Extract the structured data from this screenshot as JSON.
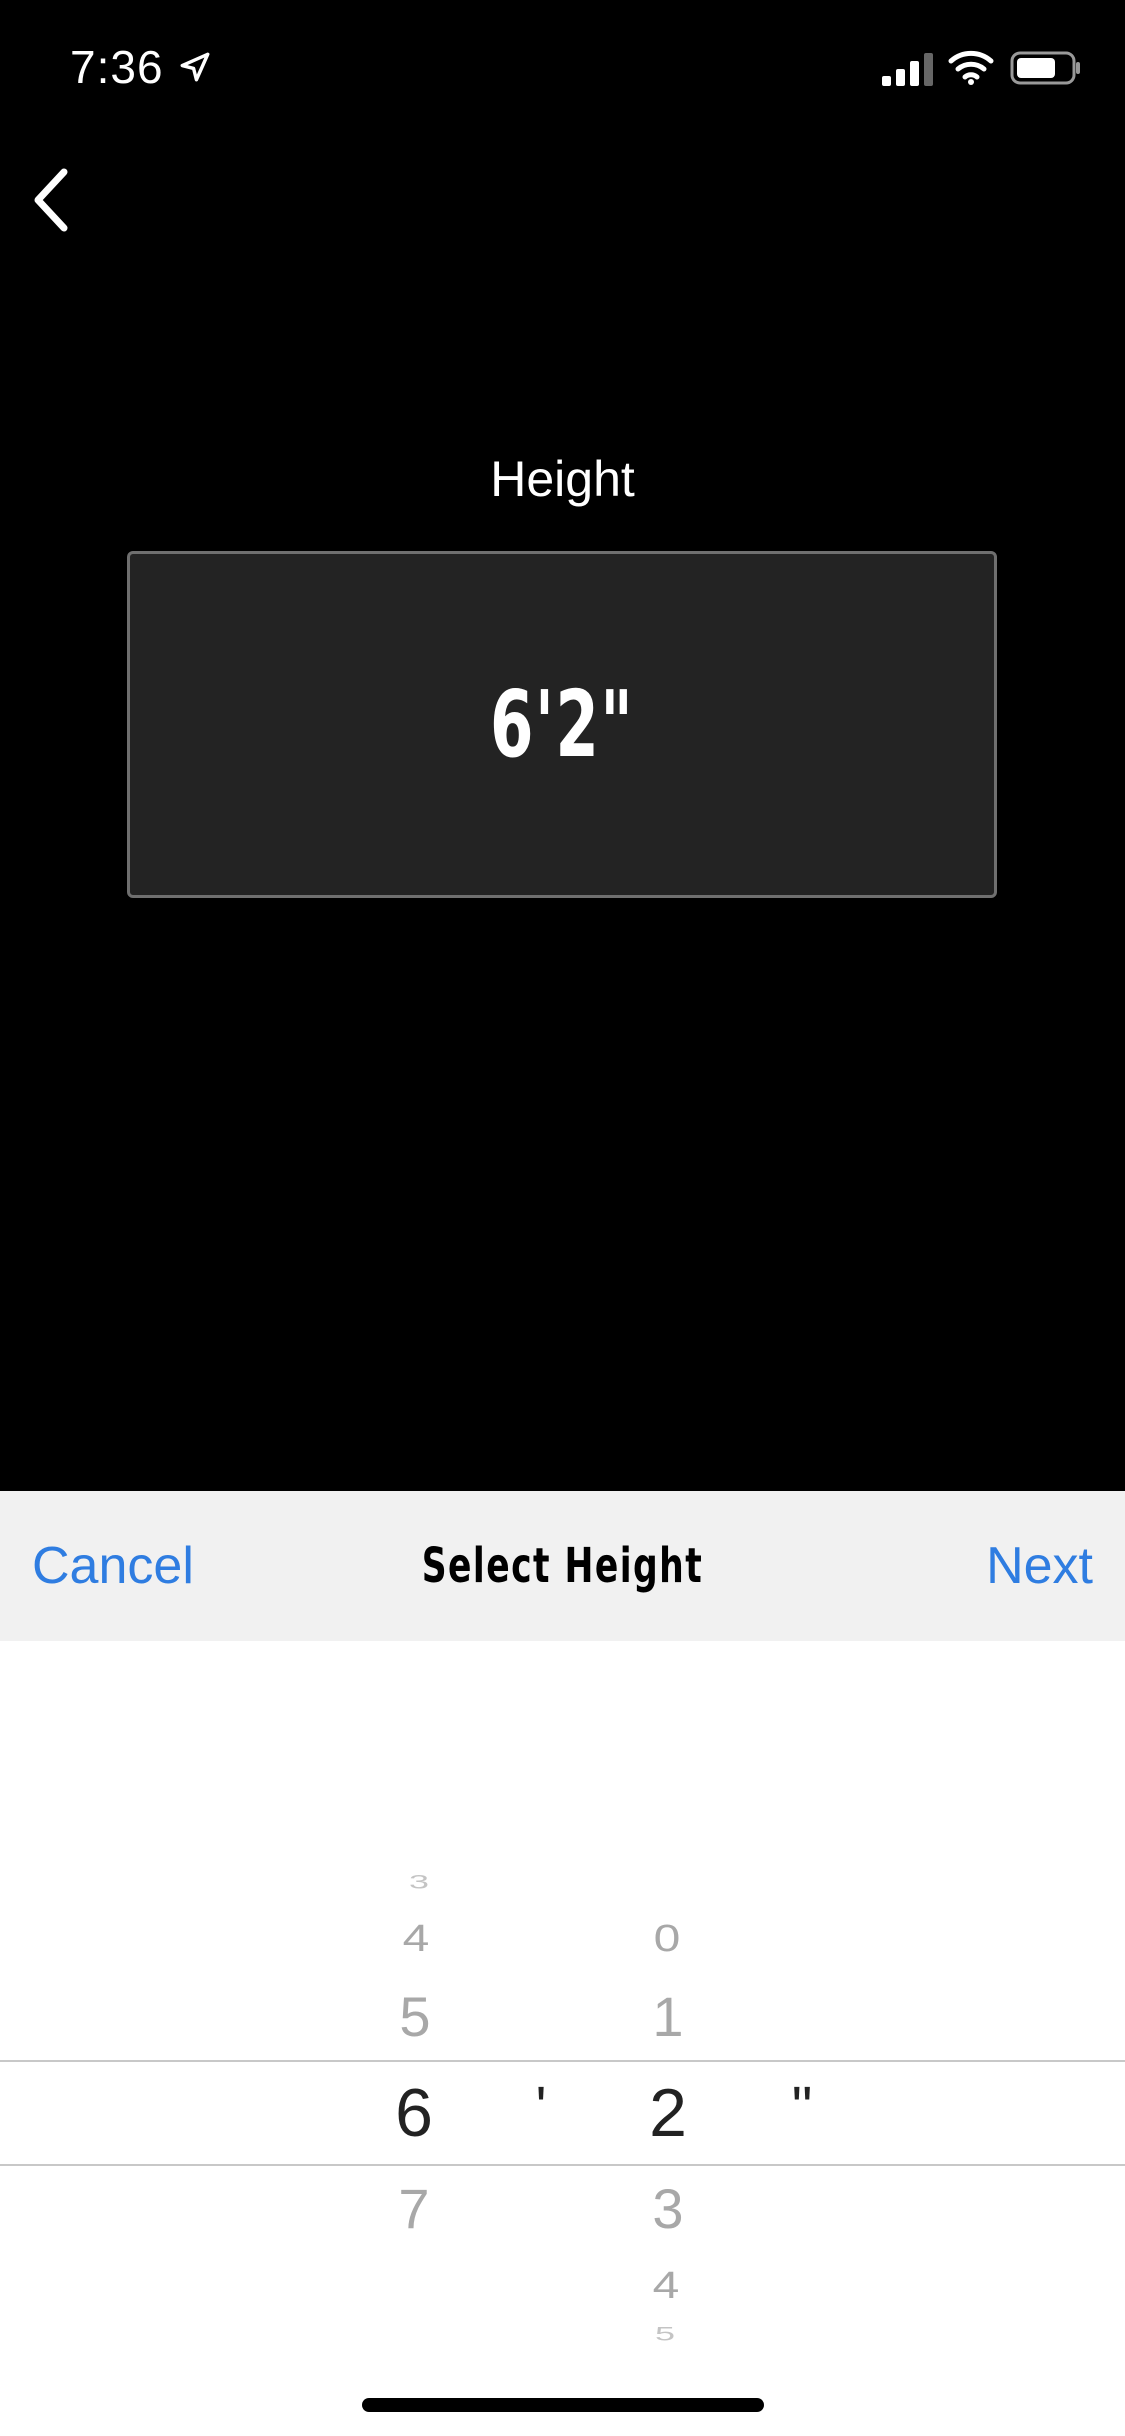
{
  "status_bar": {
    "time": "7:36"
  },
  "form": {
    "label": "Height",
    "value": "6'2\""
  },
  "toolbar": {
    "cancel": "Cancel",
    "title": "Select Height",
    "next": "Next"
  },
  "picker": {
    "feet_column": [
      "3",
      "4",
      "5",
      "6",
      "7"
    ],
    "feet_selected": "6",
    "feet_unit": "'",
    "inches_column": [
      "0",
      "1",
      "2",
      "3",
      "4",
      "5"
    ],
    "inches_selected": "2",
    "inches_unit": "\""
  },
  "colors": {
    "accent": "#2f7de1",
    "toolbar_bg": "#f1f1f1",
    "field_bg": "#232323"
  }
}
